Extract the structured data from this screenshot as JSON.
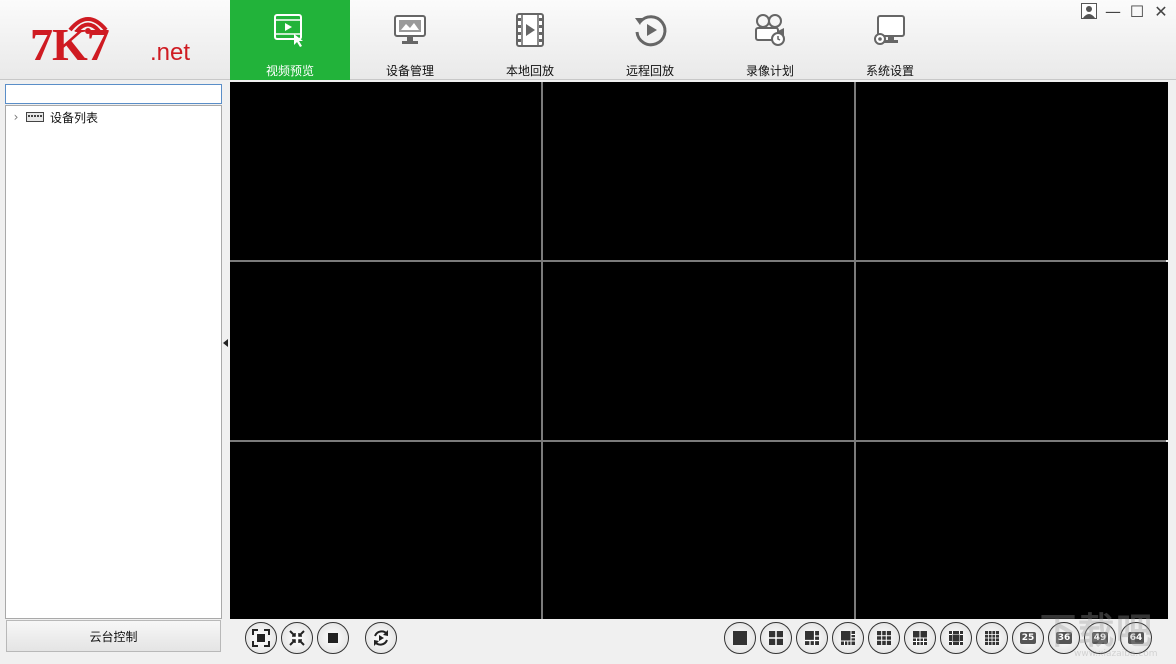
{
  "logo": {
    "main": "7K7",
    "suffix": ".net"
  },
  "nav": [
    {
      "label": "视频预览",
      "icon": "video-preview-icon",
      "active": true
    },
    {
      "label": "设备管理",
      "icon": "device-manage-icon",
      "active": false
    },
    {
      "label": "本地回放",
      "icon": "local-playback-icon",
      "active": false
    },
    {
      "label": "远程回放",
      "icon": "remote-playback-icon",
      "active": false
    },
    {
      "label": "录像计划",
      "icon": "record-plan-icon",
      "active": false
    },
    {
      "label": "系统设置",
      "icon": "system-settings-icon",
      "active": false
    }
  ],
  "window_controls": {
    "user": "👤",
    "minimize": "—",
    "maximize": "☐",
    "close": "✕"
  },
  "sidebar": {
    "search_value": "",
    "tree": [
      {
        "label": "设备列表",
        "icon": "dvr-device-icon",
        "expanded": false
      }
    ],
    "ptz_button": "云台控制"
  },
  "video_grid": {
    "rows": 3,
    "cols": 3
  },
  "toolbar": {
    "left": [
      "fullscreen-icon",
      "exit-fullscreen-icon",
      "stop-all-icon",
      "cycle-icon"
    ],
    "layouts": [
      "1",
      "4",
      "6",
      "8",
      "9",
      "10",
      "13",
      "16",
      "25",
      "36",
      "49",
      "64"
    ]
  },
  "colors": {
    "brand_red": "#cf1b22",
    "active_green": "#22b33a",
    "video_bg": "#000000"
  },
  "watermark": {
    "big": "下载吧",
    "small": "www.xiazaiba.com"
  }
}
